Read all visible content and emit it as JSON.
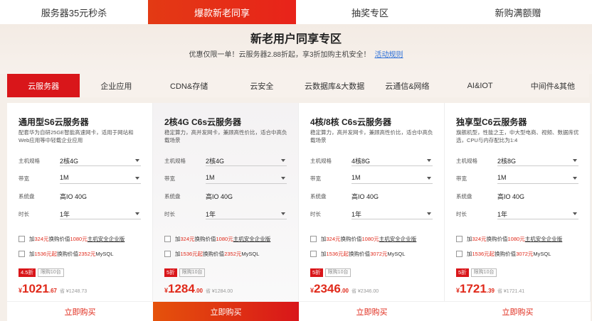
{
  "top_tabs": [
    "服务器35元秒杀",
    "爆款新老同享",
    "抽奖专区",
    "新购满额赠"
  ],
  "hero": {
    "title": "新老用户同享专区",
    "subtitle": "优惠仅限一单！云服务器2.88折起，享3折加购主机安全！",
    "rules_link": "活动规则"
  },
  "categories": [
    "云服务器",
    "企业应用",
    "CDN&存储",
    "云安全",
    "云数据库&大数据",
    "云通信&网络",
    "AI&IOT",
    "中间件&其他"
  ],
  "labels": {
    "spec": "主机规格",
    "bandwidth": "带宽",
    "disk": "系统盘",
    "duration": "时长",
    "buy": "立即购买"
  },
  "cards": [
    {
      "title": "通用型S6云服务器",
      "desc": "配套华为自研25GE智能高速网卡，适用于网站和Web应用等中轻载企业应用",
      "spec": "2核4G",
      "bandwidth": "1M",
      "disk": "高IO 40G",
      "duration": "1年",
      "addon1": {
        "a": "加",
        "b": "324元",
        "c": "换购价值",
        "d": "1080元",
        "e": "主机安全企业版"
      },
      "addon2": {
        "a": "加",
        "b": "1536元起",
        "c": "换购价值",
        "d": "2352元",
        "e": "MySQL"
      },
      "discount": "4.5折",
      "limit": "限购10台",
      "currency": "¥",
      "price_int": "1021",
      "price_dec": ".67",
      "original": "省 ¥1248.73"
    },
    {
      "title": "2核4G C6s云服务器",
      "desc": "稳定算力，高并发网卡，兼顾高性价比，适合中高负载场景",
      "spec": "2核4G",
      "bandwidth": "1M",
      "disk": "高IO 40G",
      "duration": "1年",
      "addon1": {
        "a": "加",
        "b": "324元",
        "c": "换购价值",
        "d": "1080元",
        "e": "主机安全企业版"
      },
      "addon2": {
        "a": "加",
        "b": "1536元起",
        "c": "换购价值",
        "d": "2352元",
        "e": "MySQL"
      },
      "discount": "5折",
      "limit": "限购10台",
      "currency": "¥",
      "price_int": "1284",
      "price_dec": ".00",
      "original": "省 ¥1284.00"
    },
    {
      "title": "4核/8核 C6s云服务器",
      "desc": "稳定算力，高并发网卡，兼顾高性价比，适合中高负载场景",
      "spec": "4核8G",
      "bandwidth": "1M",
      "disk": "高IO 40G",
      "duration": "1年",
      "addon1": {
        "a": "加",
        "b": "324元",
        "c": "换购价值",
        "d": "1080元",
        "e": "主机安全企业版"
      },
      "addon2": {
        "a": "加",
        "b": "1536元起",
        "c": "换购价值",
        "d": "3072元",
        "e": "MySQL"
      },
      "discount": "5折",
      "limit": "限购10台",
      "currency": "¥",
      "price_int": "2346",
      "price_dec": ".00",
      "original": "省 ¥2346.00"
    },
    {
      "title": "独享型C6云服务器",
      "desc": "旗舰机型，性能之王，中大型电商、视频、数据库优选，CPU与内存配比为1:4",
      "spec": "2核8G",
      "bandwidth": "1M",
      "disk": "高IO 40G",
      "duration": "1年",
      "addon1": {
        "a": "加",
        "b": "324元",
        "c": "换购价值",
        "d": "1080元",
        "e": "主机安全企业版"
      },
      "addon2": {
        "a": "加",
        "b": "1536元起",
        "c": "换购价值",
        "d": "3072元",
        "e": "MySQL"
      },
      "discount": "5折",
      "limit": "限购10台",
      "currency": "¥",
      "price_int": "1721",
      "price_dec": ".39",
      "original": "省 ¥1721.41"
    }
  ]
}
